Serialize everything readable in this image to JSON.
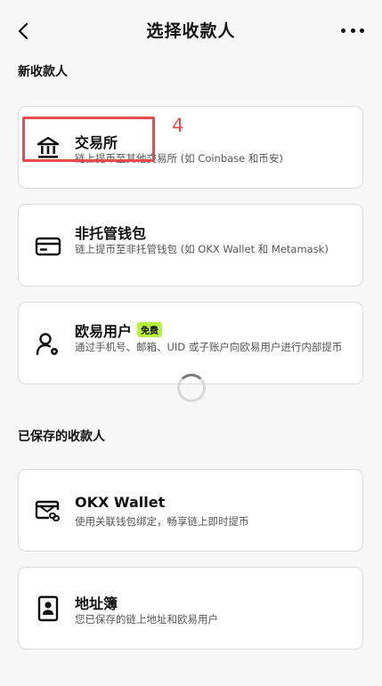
{
  "header": {
    "title": "选择收款人"
  },
  "sections": {
    "new_label": "新收款人",
    "saved_label": "已保存的收款人"
  },
  "new_payees": [
    {
      "title": "交易所",
      "desc": "链上提币至其他交易所 (如 Coinbase 和币安)"
    },
    {
      "title": "非托管钱包",
      "desc": "链上提币至非托管钱包 (如 OKX Wallet 和 Metamask)"
    },
    {
      "title": "欧易用户",
      "badge": "免费",
      "desc": "通过手机号、邮箱、UID 或子账户向欧易用户进行内部提币"
    }
  ],
  "saved_payees": [
    {
      "title": "OKX Wallet",
      "desc": "使用关联钱包绑定，畅享链上即时提币"
    },
    {
      "title": "地址簿",
      "desc": "您已保存的链上地址和欧易用户"
    }
  ],
  "annotation": {
    "number": "4",
    "color": "#e74c4c"
  },
  "colors": {
    "badge": "#b9f23c",
    "background": "#f7f7f7"
  },
  "icons": {
    "back": "chevron-left-icon",
    "more": "more-horizontal-icon",
    "exchange": "bank-icon",
    "wallet": "card-icon",
    "user": "user-settings-icon",
    "okx_wallet": "wallet-link-icon",
    "address_book": "address-book-icon",
    "loading": "spinner-icon"
  }
}
